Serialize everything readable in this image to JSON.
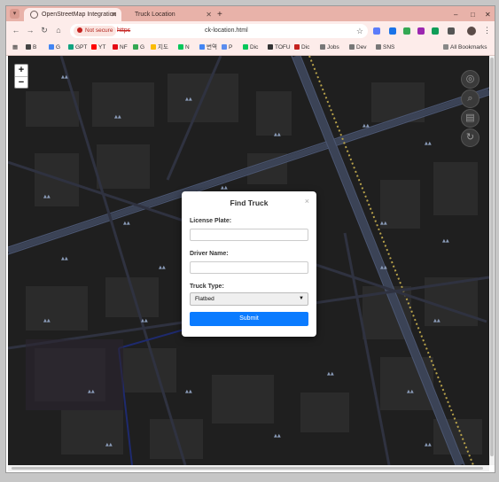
{
  "browser": {
    "tabs": [
      {
        "label": "OpenStreetMap Integration",
        "active": true
      },
      {
        "label": "Truck Location",
        "active": false
      }
    ],
    "new_tab_symbol": "+",
    "window_controls": {
      "minimize": "–",
      "maximize": "□",
      "close": "✕"
    },
    "nav": {
      "back": "←",
      "forward": "→",
      "reload": "↻",
      "home": "⌂"
    },
    "address": {
      "security_chip": "Not secure",
      "scheme": "https",
      "path": "ck-location.html"
    },
    "bookmarks": [
      {
        "label": "B",
        "color": "#444444"
      },
      {
        "label": "G",
        "color": "#4285f4"
      },
      {
        "label": "GPT",
        "color": "#10a37f"
      },
      {
        "label": "YT",
        "color": "#ff0000"
      },
      {
        "label": "NF",
        "color": "#e50914"
      },
      {
        "label": "G",
        "color": "#34a853"
      },
      {
        "label": "지도",
        "color": "#fbbc05"
      },
      {
        "label": "N",
        "color": "#03c75a"
      },
      {
        "label": "번역",
        "color": "#4285f4"
      },
      {
        "label": "P",
        "color": "#5b8def"
      },
      {
        "label": "Dic",
        "color": "#03c75a"
      },
      {
        "label": "TOFU",
        "color": "#333333"
      },
      {
        "label": "Dic",
        "color": "#c5221f"
      },
      {
        "label": "Jobs",
        "color": "#777777"
      },
      {
        "label": "Dev",
        "color": "#777777"
      },
      {
        "label": "SNS",
        "color": "#777777"
      }
    ],
    "all_bookmarks": "All Bookmarks",
    "extension_colors": [
      "#5b7cfa",
      "#1a73e8",
      "#34a853",
      "#9c27b0",
      "#0f9d58",
      "#555555"
    ]
  },
  "map": {
    "zoom_in": "+",
    "zoom_out": "−",
    "controls": [
      "locate-icon",
      "search-icon",
      "layers-icon",
      "refresh-icon"
    ],
    "control_glyphs": [
      "◎",
      "⌕",
      "▤",
      "↻"
    ]
  },
  "modal": {
    "title": "Find Truck",
    "close": "×",
    "license_label": "License Plate:",
    "license_value": "",
    "driver_label": "Driver Name:",
    "driver_value": "",
    "type_label": "Truck Type:",
    "type_selected": "Flatbed",
    "submit_label": "Submit",
    "accent_color": "#0a7bff"
  }
}
